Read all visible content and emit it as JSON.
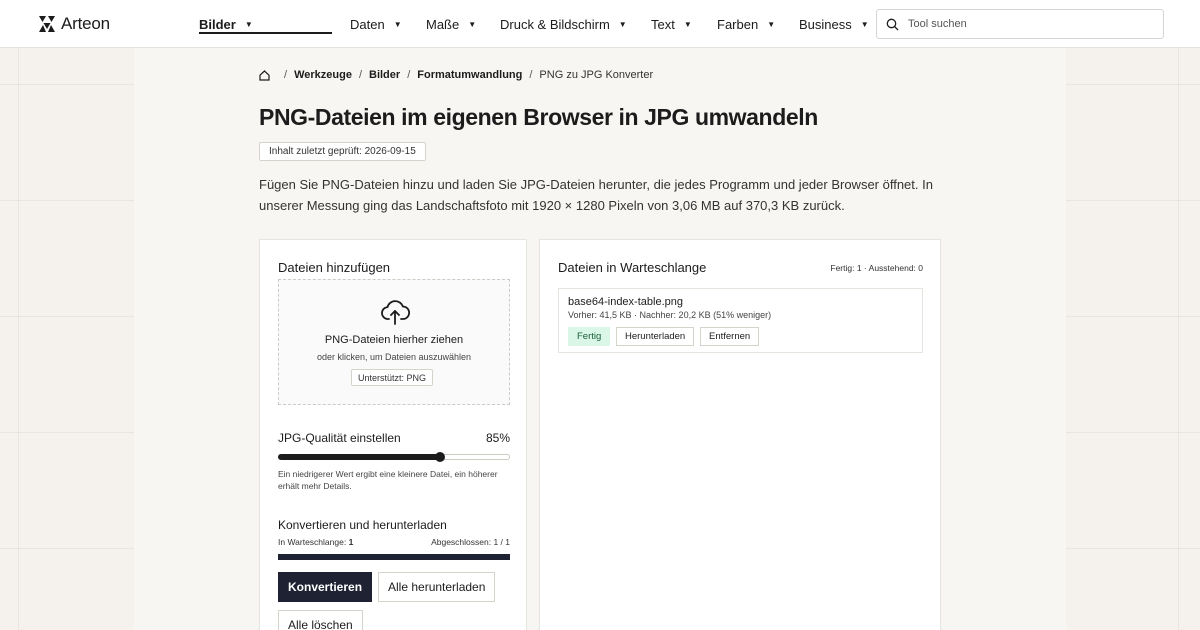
{
  "header": {
    "logo_text": "Arteon",
    "nav": [
      {
        "label": "Bilder",
        "active": true
      },
      {
        "label": "Daten"
      },
      {
        "label": "Maße"
      },
      {
        "label": "Druck & Bildschirm"
      },
      {
        "label": "Text"
      },
      {
        "label": "Farben"
      },
      {
        "label": "Business"
      }
    ],
    "search_placeholder": "Tool suchen"
  },
  "breadcrumb": {
    "items": [
      "Werkzeuge",
      "Bilder",
      "Formatumwandlung"
    ],
    "current": "PNG zu JPG Konverter",
    "separator": "/"
  },
  "page": {
    "title": "PNG-Dateien im eigenen Browser in JPG umwandeln",
    "badge": "Inhalt zuletzt geprüft: 2026-09-15",
    "intro": "Fügen Sie PNG-Dateien hinzu und laden Sie JPG-Dateien herunter, die jedes Programm und jeder Browser öffnet. In unserer Messung ging das Landschaftsfoto mit 1920 × 1280 Pixeln von 3,06 MB auf 370,3 KB zurück."
  },
  "upload": {
    "title": "Dateien hinzufügen",
    "drop_title": "PNG-Dateien hierher ziehen",
    "drop_sub": "oder klicken, um Dateien auszuwählen",
    "supported": "Unterstützt: PNG"
  },
  "quality": {
    "label": "JPG-Qualität einstellen",
    "value_text": "85%",
    "value": 85,
    "hint": "Ein niedrigerer Wert ergibt eine kleinere Datei, ein höherer erhält mehr Details."
  },
  "convert": {
    "title": "Konvertieren und herunterladen",
    "queued_label": "In Warteschlange:",
    "queued_value": "1",
    "done_text": "Abgeschlossen: 1 / 1",
    "progress": 1.0,
    "btn_convert": "Konvertieren",
    "btn_download_all": "Alle herunterladen",
    "btn_clear": "Alle löschen"
  },
  "queue": {
    "title": "Dateien in Warteschlange",
    "status": "Fertig: 1 · Ausstehend: 0",
    "files": [
      {
        "name": "base64-index-table.png",
        "size": "Vorher: 41,5 KB · Nachher: 20,2 KB (51% weniger)",
        "status": "Fertig",
        "download": "Herunterladen",
        "remove": "Entfernen"
      }
    ]
  },
  "colors": {
    "accent": "#1f2233",
    "done_bg": "#d9f6e6"
  }
}
